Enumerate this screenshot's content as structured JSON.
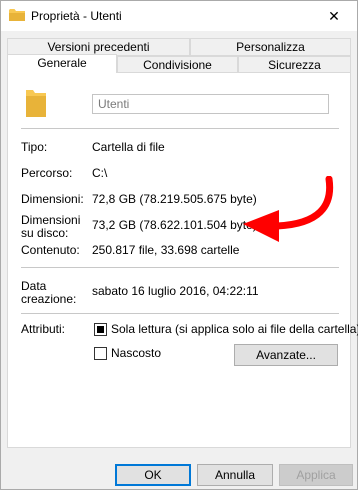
{
  "window": {
    "title": "Proprietà - Utenti",
    "close_symbol": "✕"
  },
  "tabs": {
    "row1": [
      "Versioni precedenti",
      "Personalizza"
    ],
    "row2": [
      "Generale",
      "Condivisione",
      "Sicurezza"
    ],
    "active": "Generale"
  },
  "general": {
    "name_value": "Utenti",
    "rows": [
      {
        "label": "Tipo:",
        "value": "Cartella di file"
      },
      {
        "label": "Percorso:",
        "value": "C:\\"
      },
      {
        "label": "Dimensioni:",
        "value": "72,8 GB (78.219.505.675 byte)"
      },
      {
        "label_line1": "Dimensioni",
        "label_line2": "su disco:",
        "value": "73,2 GB (78.622.101.504 byte)"
      },
      {
        "label": "Contenuto:",
        "value": "250.817 file, 33.698 cartelle"
      },
      {
        "label_line1": "Data",
        "label_line2": "creazione:",
        "value": "sabato 16 luglio 2016, 04:22:11"
      }
    ],
    "attributes_label": "Attributi:",
    "readonly_label": "Sola lettura (si applica solo ai file della cartella)",
    "readonly_state": "indeterminate",
    "hidden_label": "Nascosto",
    "hidden_state": "unchecked",
    "advanced_button": "Avanzate..."
  },
  "buttons": {
    "ok": "OK",
    "cancel": "Annulla",
    "apply": "Applica"
  },
  "colors": {
    "annotation_arrow": "#ff0000",
    "folder": "#f8c852",
    "default_button_border": "#0078d7"
  },
  "icons": {
    "title": "folder-icon",
    "big": "folder-icon",
    "close": "close-icon",
    "annotation": "red-arrow-annotation"
  }
}
